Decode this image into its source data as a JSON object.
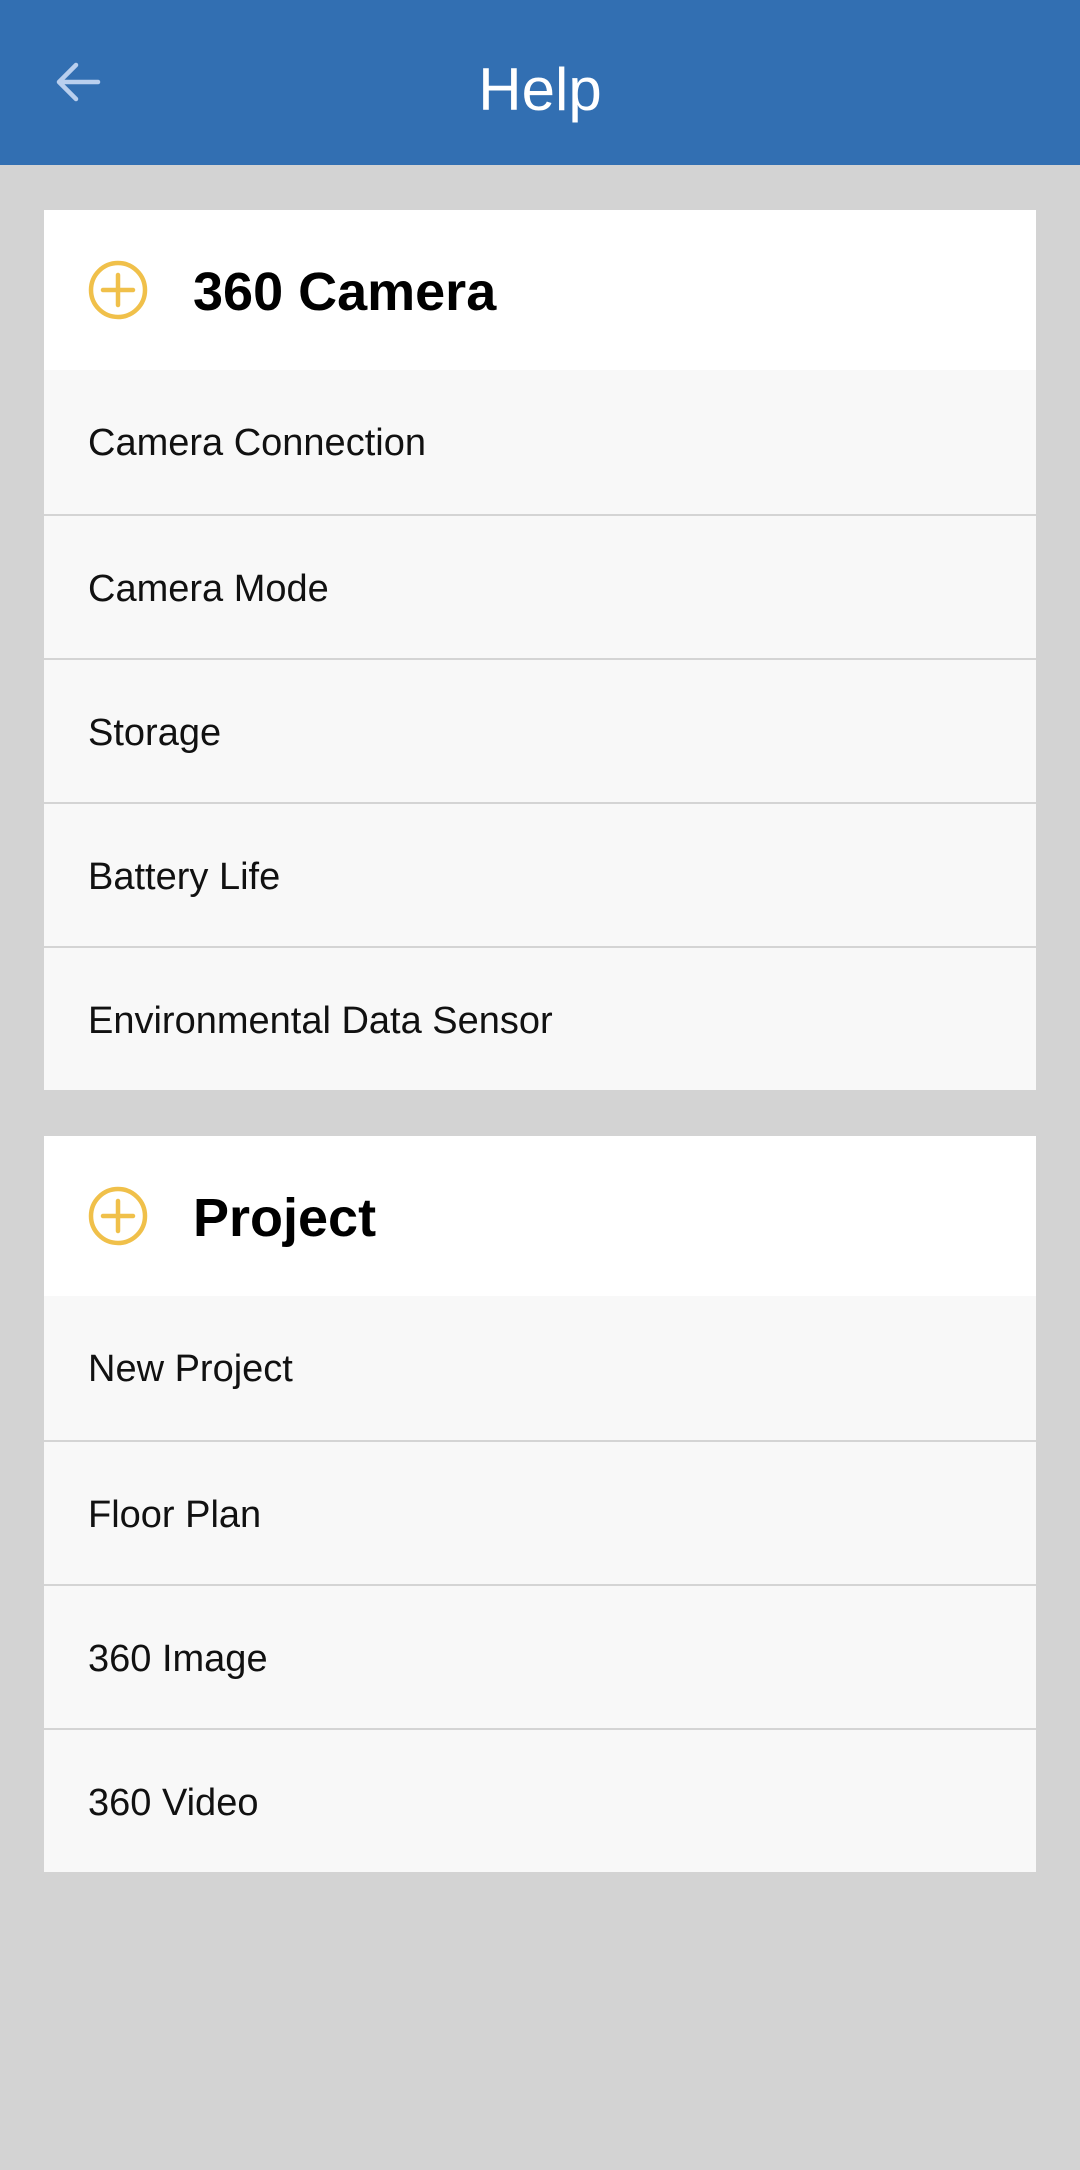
{
  "header": {
    "title": "Help",
    "background_color": "#326fb2",
    "back_icon": "arrow-left-icon"
  },
  "sections": [
    {
      "title": "360 Camera",
      "expand_icon": "plus-circle-icon",
      "icon_color": "#f0c04a",
      "items": [
        {
          "label": "Camera Connection"
        },
        {
          "label": "Camera Mode"
        },
        {
          "label": "Storage"
        },
        {
          "label": "Battery Life"
        },
        {
          "label": "Environmental Data Sensor"
        }
      ]
    },
    {
      "title": "Project",
      "expand_icon": "plus-circle-icon",
      "icon_color": "#f0c04a",
      "items": [
        {
          "label": "New Project"
        },
        {
          "label": "Floor Plan"
        },
        {
          "label": "360 Image"
        },
        {
          "label": "360 Video"
        }
      ]
    }
  ]
}
